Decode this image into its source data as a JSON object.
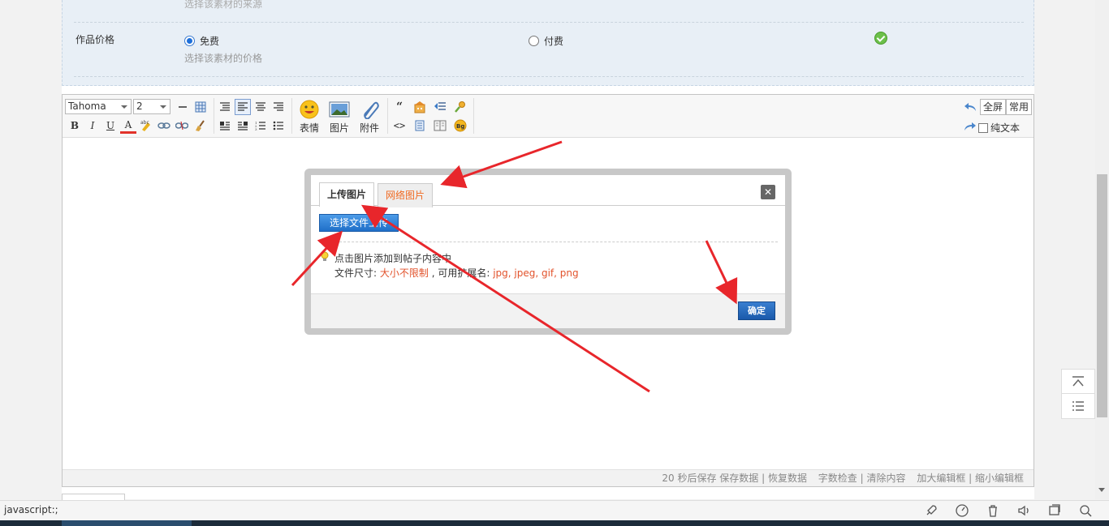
{
  "form": {
    "top_hint": "选择该素材的来源",
    "price_label": "作品价格",
    "option_free": "免费",
    "option_paid": "付费",
    "price_hint": "选择该素材的价格"
  },
  "toolbar": {
    "font_name": "Tahoma",
    "font_size": "2",
    "bold": "B",
    "italic": "I",
    "underline": "U",
    "font_color": "A",
    "emoji_label": "表情",
    "image_label": "图片",
    "attachment_label": "附件",
    "quote": "“",
    "code": "<>",
    "fullscreen": "全屏",
    "common": "常用",
    "plaintext": "纯文本"
  },
  "status_bar": {
    "autosave": "20 秒后保存 保存数据 | 恢复数据",
    "wordcheck": "字数检查 | 清除内容",
    "resize": "加大编辑框 | 缩小编辑框"
  },
  "dialog": {
    "tab_upload": "上传图片",
    "tab_network": "网络图片",
    "close": "✕",
    "upload_button": "选择文件上传",
    "tip_line1": "点击图片添加到帖子内容中",
    "size_label": "文件尺寸: ",
    "size_value": "大小不限制",
    "ext_label": " , 可用扩展名: ",
    "ext_value": "jpg, jpeg, gif, png",
    "confirm": "确定"
  },
  "browser": {
    "status_url": "javascript:;"
  },
  "colors": {
    "accent_blue": "#1f6fc8",
    "highlight_orange": "#f06a22",
    "annotation_red": "#e8262b"
  }
}
